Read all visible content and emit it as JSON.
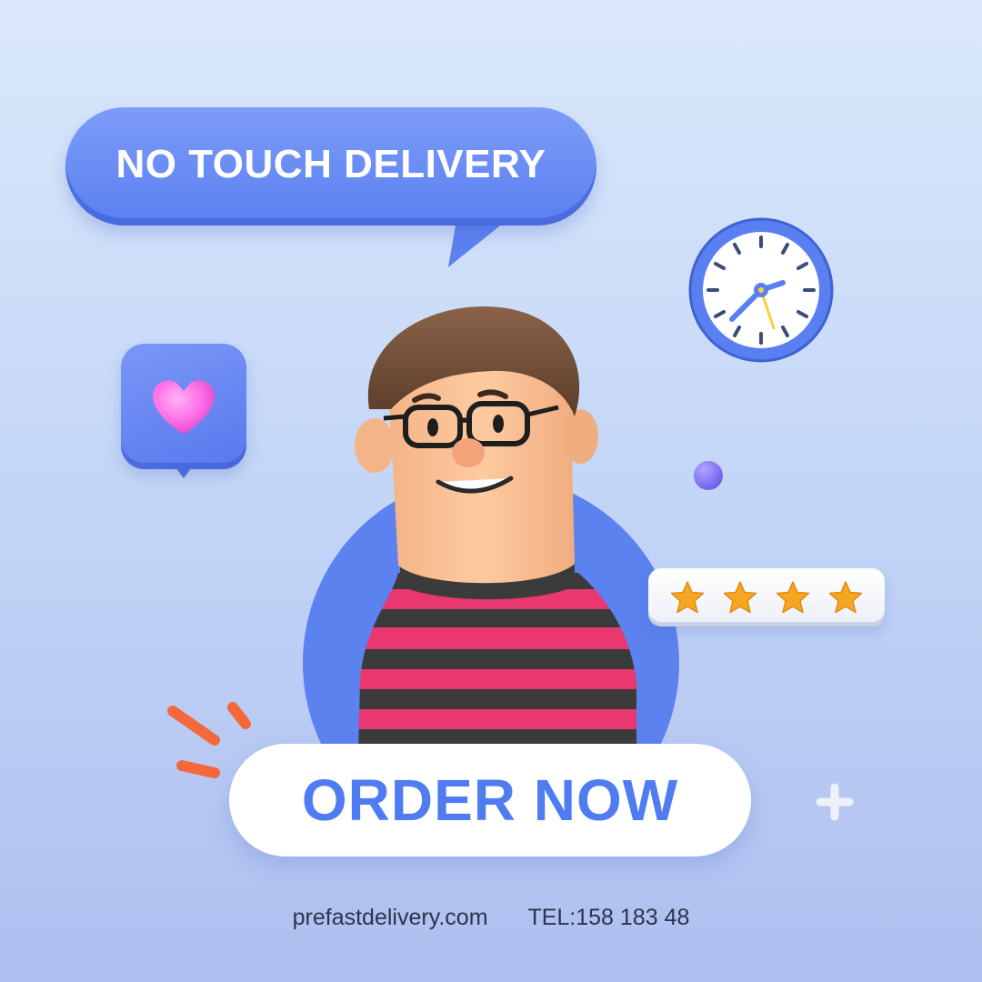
{
  "headline": {
    "text": "NO TOUCH DELIVERY"
  },
  "cta": {
    "label": "ORDER NOW"
  },
  "rating": {
    "stars": 4
  },
  "footer": {
    "website": "prefastdelivery.com",
    "phone": "TEL:158 183 48"
  },
  "colors": {
    "accent_blue": "#5b82ef",
    "cta_text": "#4f7cf0",
    "heart_pink": "#ff6fe8",
    "star_orange": "#f5a623",
    "spark_orange": "#f4683a",
    "shirt_pink": "#e8386f",
    "shirt_stripe": "#3b3b3b"
  },
  "icons": {
    "heart": "heart-icon",
    "clock": "clock-icon",
    "star": "star-icon",
    "plus": "plus-icon",
    "sparks": "spark-lines-icon",
    "speech_bubble": "speech-bubble-icon"
  }
}
